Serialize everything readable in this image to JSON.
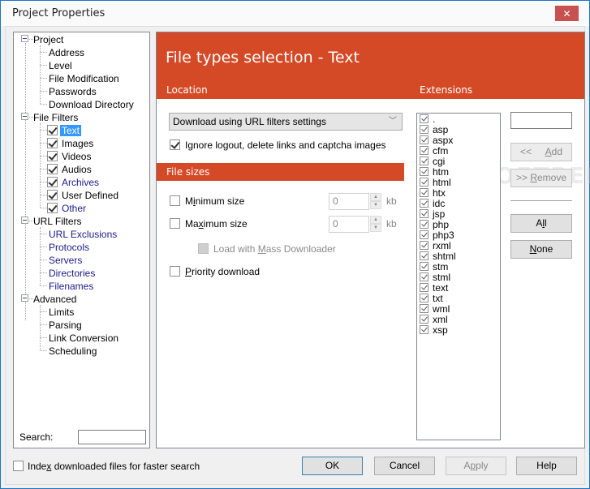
{
  "window": {
    "title": "Project Properties",
    "close_icon": "close-icon"
  },
  "tree": {
    "groups": [
      {
        "label": "Project",
        "expanded": true,
        "children": [
          {
            "label": "Address"
          },
          {
            "label": "Level"
          },
          {
            "label": "File Modification"
          },
          {
            "label": "Passwords"
          },
          {
            "label": "Download Directory"
          }
        ]
      },
      {
        "label": "File Filters",
        "expanded": true,
        "children": [
          {
            "label": "Text",
            "checked": true,
            "selected": true
          },
          {
            "label": "Images",
            "checked": true
          },
          {
            "label": "Videos",
            "checked": true
          },
          {
            "label": "Audios",
            "checked": true
          },
          {
            "label": "Archives",
            "checked": true,
            "link": true
          },
          {
            "label": "User Defined",
            "checked": true
          },
          {
            "label": "Other",
            "checked": true,
            "link": true
          }
        ]
      },
      {
        "label": "URL Filters",
        "expanded": true,
        "children": [
          {
            "label": "URL Exclusions",
            "link": true
          },
          {
            "label": "Protocols",
            "link": true
          },
          {
            "label": "Servers",
            "link": true
          },
          {
            "label": "Directories",
            "link": true
          },
          {
            "label": "Filenames",
            "link": true
          }
        ]
      },
      {
        "label": "Advanced",
        "expanded": true,
        "children": [
          {
            "label": "Limits"
          },
          {
            "label": "Parsing"
          },
          {
            "label": "Link Conversion"
          },
          {
            "label": "Scheduling"
          }
        ]
      }
    ],
    "search_label": "Search:",
    "search_value": ""
  },
  "main": {
    "title": "File types selection - Text",
    "location_label": "Location",
    "extensions_label": "Extensions",
    "location_select": "Download using URL filters settings",
    "ignore_logout_label": "Ignore logout, delete links and captcha images",
    "ignore_logout_checked": true,
    "file_sizes_label": "File sizes",
    "min_size": {
      "label_pre": "M",
      "label_u": "i",
      "label_post": "nimum size",
      "checked": false,
      "value": "0",
      "unit": "kb"
    },
    "max_size": {
      "label_pre": "Ma",
      "label_u": "x",
      "label_post": "imum size",
      "checked": false,
      "value": "0",
      "unit": "kb"
    },
    "mass_downloader": {
      "label_pre": "Load with ",
      "label_u": "M",
      "label_post": "ass Downloader",
      "checked": false,
      "disabled": true
    },
    "priority": {
      "label_pre": "",
      "label_u": "P",
      "label_post": "riority download",
      "checked": false
    },
    "extensions": [
      ".",
      "asp",
      "aspx",
      "cfm",
      "cgi",
      "htm",
      "html",
      "htx",
      "idc",
      "jsp",
      "php",
      "php3",
      "rxml",
      "shtml",
      "stm",
      "stml",
      "text",
      "txt",
      "wml",
      "xml",
      "xsp"
    ],
    "extension_input": "",
    "add_button": {
      "prefix": "<<",
      "u": "A",
      "rest": "dd"
    },
    "remove_button": {
      "prefix": ">> ",
      "u": "R",
      "rest": "emove"
    },
    "all_button": {
      "pre": "A",
      "u": "l",
      "rest": "l"
    },
    "none_button": {
      "pre": "",
      "u": "N",
      "rest": "one"
    },
    "watermark": "SOFTPEDIA"
  },
  "footer": {
    "index_label_pre": "Inde",
    "index_label_u": "x",
    "index_label_post": " downloaded files for faster search",
    "index_checked": false,
    "ok": "OK",
    "cancel": "Cancel",
    "apply_pre": "A",
    "apply_u": "p",
    "apply_post": "ply",
    "help": "Help"
  }
}
